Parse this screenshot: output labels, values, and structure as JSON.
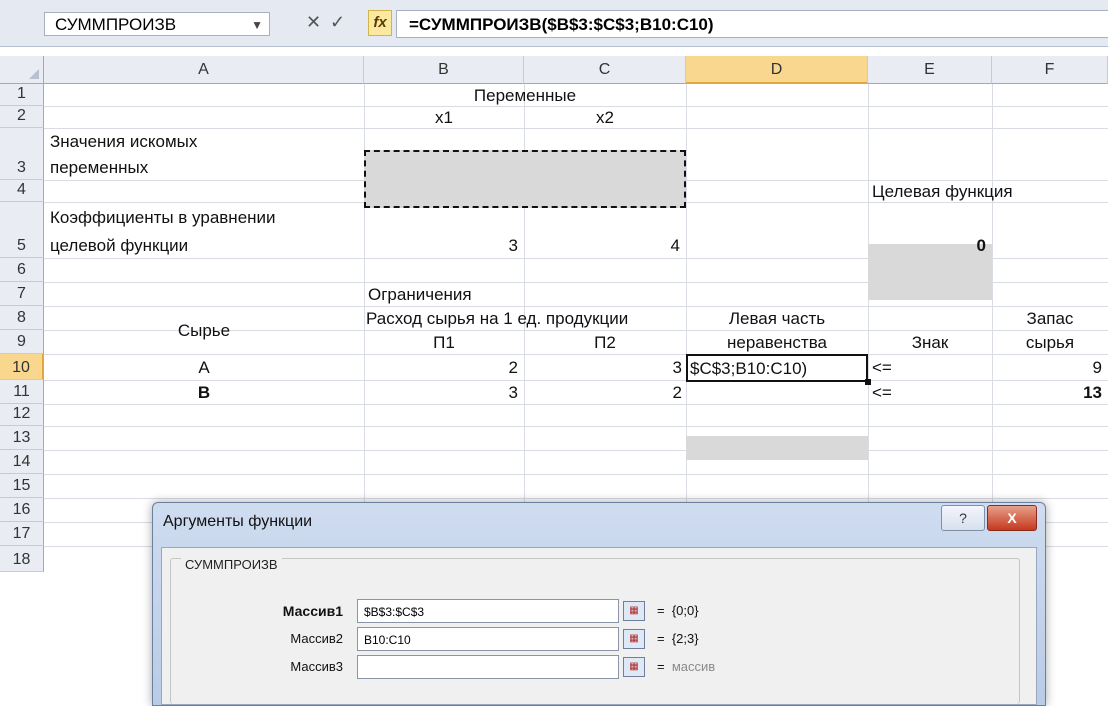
{
  "formula_bar": {
    "name_box": "СУММПРОИЗВ",
    "cancel_symbol": "✕",
    "enter_symbol": "✓",
    "fx_label": "fx",
    "formula": "=СУММПРОИЗВ($B$3:$C$3;B10:C10)"
  },
  "columns": [
    "A",
    "B",
    "C",
    "D",
    "E",
    "F"
  ],
  "rows": [
    "1",
    "2",
    "3",
    "4",
    "5",
    "6",
    "7",
    "8",
    "9",
    "10",
    "11",
    "12",
    "13",
    "14",
    "15",
    "16",
    "17",
    "18"
  ],
  "cells": {
    "B1": "Переменные",
    "B2": "x1",
    "C2": "x2",
    "A3_line1": "Значения искомых",
    "A3_line2": "переменных",
    "E4": "Целевая функция",
    "A5_line1": "Коэффициенты в уравнении",
    "A5_line2": "целевой функции",
    "B5": "3",
    "C5": "4",
    "E5": "0",
    "B7": "Ограничения",
    "A8": "Сырье",
    "B8": "Расход сырья на 1 ед. продукции",
    "D8": "Левая часть",
    "F8": "Запас",
    "B9": "П1",
    "C9": "П2",
    "D9": "неравенства",
    "E9": "Знак",
    "F9": "сырья",
    "A10": "A",
    "B10": "2",
    "C10": "3",
    "D10": "$C$3;B10:C10)",
    "E10": "<=",
    "F10": "9",
    "A11": "B",
    "B11": "3",
    "C11": "2",
    "E11": "<=",
    "F11": "13"
  },
  "dialog": {
    "title": "Аргументы функции",
    "help": "?",
    "close": "X",
    "function_name": "СУММПРОИЗВ",
    "args": [
      {
        "label": "Массив1",
        "value": "$B$3:$C$3",
        "result": "{0;0}",
        "bold": true
      },
      {
        "label": "Массив2",
        "value": "B10:C10",
        "result": "{2;3}",
        "bold": false
      },
      {
        "label": "Массив3",
        "value": "",
        "result": "массив",
        "bold": false
      }
    ],
    "equals": "="
  }
}
